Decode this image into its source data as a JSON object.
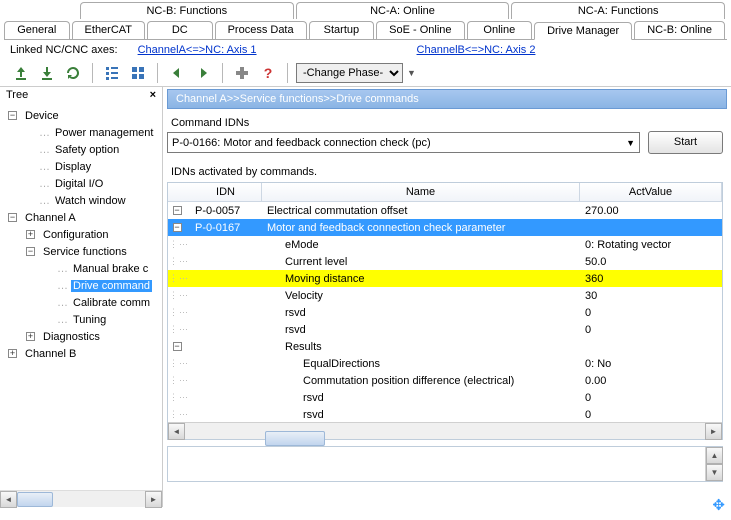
{
  "tabs_row1": [
    "NC-B: Functions",
    "NC-A: Online",
    "NC-A: Functions"
  ],
  "tabs_row2": [
    "General",
    "EtherCAT",
    "DC",
    "Process Data",
    "Startup",
    "SoE - Online",
    "Online",
    "Drive Manager",
    "NC-B: Online"
  ],
  "active_tab": "Drive Manager",
  "linked": {
    "label": "Linked NC/CNC axes:",
    "a": "ChannelA<=>NC: Axis 1",
    "b": "ChannelB<=>NC: Axis 2"
  },
  "phase_label": "-Change Phase-",
  "tree": {
    "title": "Tree",
    "nodes": [
      {
        "label": "Device",
        "indent": 0,
        "exp": "-"
      },
      {
        "label": "Power management",
        "indent": 1,
        "exp": ""
      },
      {
        "label": "Safety option",
        "indent": 1,
        "exp": ""
      },
      {
        "label": "Display",
        "indent": 1,
        "exp": ""
      },
      {
        "label": "Digital I/O",
        "indent": 1,
        "exp": ""
      },
      {
        "label": "Watch window",
        "indent": 1,
        "exp": ""
      },
      {
        "label": "Channel A",
        "indent": 0,
        "exp": "-"
      },
      {
        "label": "Configuration",
        "indent": 1,
        "exp": "+"
      },
      {
        "label": "Service functions",
        "indent": 1,
        "exp": "-"
      },
      {
        "label": "Manual brake c",
        "indent": 2,
        "exp": ""
      },
      {
        "label": "Drive command",
        "indent": 2,
        "exp": "",
        "selected": true
      },
      {
        "label": "Calibrate comm",
        "indent": 2,
        "exp": ""
      },
      {
        "label": "Tuning",
        "indent": 2,
        "exp": ""
      },
      {
        "label": "Diagnostics",
        "indent": 1,
        "exp": "+"
      },
      {
        "label": "Channel B",
        "indent": 0,
        "exp": "+"
      }
    ]
  },
  "breadcrumb": "Channel A>>Service functions>>Drive commands",
  "cmd": {
    "label": "Command IDNs",
    "value": "P-0-0166: Motor and feedback connection check (pc)",
    "start": "Start"
  },
  "idns_label": "IDNs activated by commands.",
  "table": {
    "headers": {
      "idn": "IDN",
      "name": "Name",
      "val": "ActValue"
    },
    "rows": [
      {
        "tree": "-",
        "idn": "P-0-0057",
        "name": "Electrical commutation offset",
        "val": "270.00"
      },
      {
        "tree": "-",
        "idn": "P-0-0167",
        "name": "Motor and feedback connection check parameter",
        "val": "",
        "selected": true
      },
      {
        "tree": "",
        "idn": "",
        "name": "eMode",
        "val": "0: Rotating vector",
        "indent": 1
      },
      {
        "tree": "",
        "idn": "",
        "name": "Current level",
        "val": "50.0",
        "indent": 1
      },
      {
        "tree": "",
        "idn": "",
        "name": "Moving distance",
        "val": "360",
        "indent": 1,
        "highlight": true
      },
      {
        "tree": "",
        "idn": "",
        "name": "Velocity",
        "val": "30",
        "indent": 1
      },
      {
        "tree": "",
        "idn": "",
        "name": "rsvd",
        "val": "0",
        "indent": 1
      },
      {
        "tree": "",
        "idn": "",
        "name": "rsvd",
        "val": "0",
        "indent": 1
      },
      {
        "tree": "-",
        "idn": "",
        "name": "Results",
        "val": "",
        "indent": 1
      },
      {
        "tree": "",
        "idn": "",
        "name": "EqualDirections",
        "val": "0: No",
        "indent": 2
      },
      {
        "tree": "",
        "idn": "",
        "name": "Commutation position difference (electrical)",
        "val": "0.00",
        "indent": 2
      },
      {
        "tree": "",
        "idn": "",
        "name": "rsvd",
        "val": "0",
        "indent": 2
      },
      {
        "tree": "",
        "idn": "",
        "name": "rsvd",
        "val": "0",
        "indent": 2
      }
    ]
  }
}
